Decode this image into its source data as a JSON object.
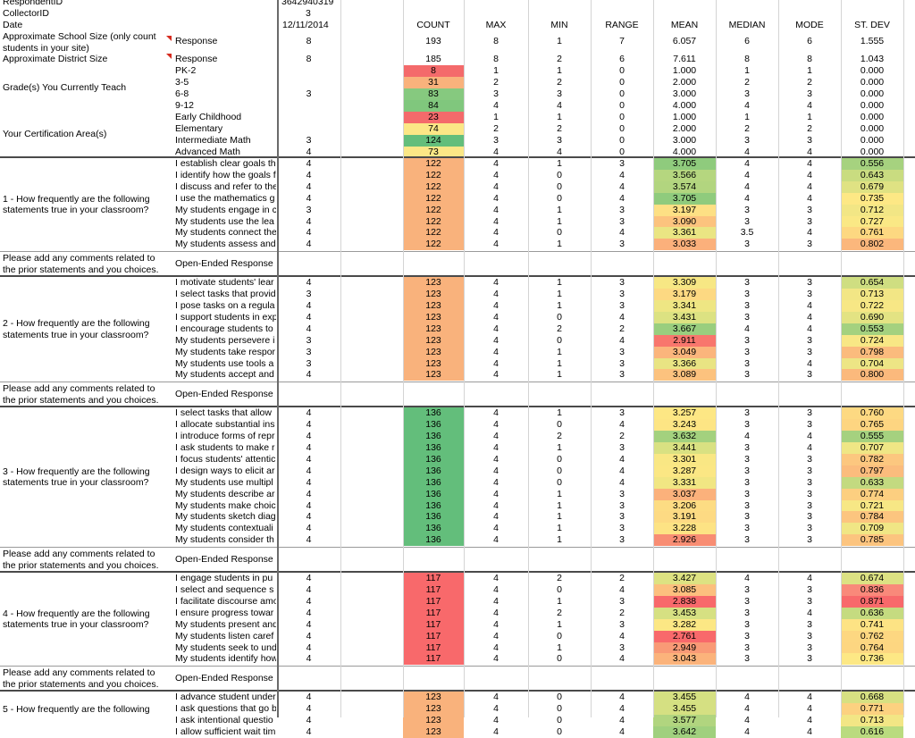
{
  "header_rows": {
    "respondent_id": {
      "label": "RespondentID",
      "value": "3642940319"
    },
    "collector_id": {
      "label": "CollectorID",
      "value": "3"
    },
    "date": {
      "label": "Date",
      "value": "12/11/2014"
    }
  },
  "stat_columns": [
    "COUNT",
    "MAX",
    "MIN",
    "RANGE",
    "MEAN",
    "MEDIAN",
    "MODE",
    "ST. DEV"
  ],
  "demographics": {
    "school_size": {
      "label": "Approximate School Size (only count students in your site)",
      "sub": "Response",
      "value": "8",
      "stats": [
        "193",
        "8",
        "1",
        "7",
        "6.057",
        "6",
        "6",
        "1.555"
      ]
    },
    "district_size": {
      "label": "Approximate District Size",
      "sub": "Response",
      "value": "8",
      "stats": [
        "185",
        "8",
        "2",
        "6",
        "7.611",
        "8",
        "8",
        "1.043"
      ]
    },
    "grades": {
      "label": "Grade(s) You Currently Teach",
      "rows": [
        {
          "sub": "PK-2",
          "value": "",
          "count": "8",
          "count_color": "#f46a6b",
          "stats": [
            "1",
            "1",
            "0",
            "1.000",
            "1",
            "1",
            "0.000"
          ]
        },
        {
          "sub": "3-5",
          "value": "",
          "count": "31",
          "count_color": "#f9b27c",
          "stats": [
            "2",
            "2",
            "0",
            "2.000",
            "2",
            "2",
            "0.000"
          ]
        },
        {
          "sub": "6-8",
          "value": "3",
          "count": "83",
          "count_color": "#86c97f",
          "stats": [
            "3",
            "3",
            "0",
            "3.000",
            "3",
            "3",
            "0.000"
          ]
        },
        {
          "sub": "9-12",
          "value": "",
          "count": "84",
          "count_color": "#80c77d",
          "stats": [
            "4",
            "4",
            "0",
            "4.000",
            "4",
            "4",
            "0.000"
          ]
        }
      ]
    },
    "certification": {
      "label": "Your Certification Area(s)",
      "rows": [
        {
          "sub": "Early Childhood",
          "value": "",
          "count": "23",
          "count_color": "#f46a6b",
          "stats": [
            "1",
            "1",
            "0",
            "1.000",
            "1",
            "1",
            "0.000"
          ]
        },
        {
          "sub": "Elementary",
          "value": "",
          "count": "74",
          "count_color": "#fbe786",
          "stats": [
            "2",
            "2",
            "0",
            "2.000",
            "2",
            "2",
            "0.000"
          ]
        },
        {
          "sub": "Intermediate Math",
          "value": "3",
          "count": "124",
          "count_color": "#63be7b",
          "stats": [
            "3",
            "3",
            "0",
            "3.000",
            "3",
            "3",
            "0.000"
          ]
        },
        {
          "sub": "Advanced Math",
          "value": "4",
          "count": "73",
          "count_color": "#fbe786",
          "stats": [
            "4",
            "4",
            "0",
            "4.000",
            "4",
            "4",
            "0.000"
          ]
        }
      ]
    }
  },
  "comment_label": "Please add any comments related to the prior statements and you choices.",
  "open_ended": "Open-Ended Response",
  "questions": [
    {
      "label": "1 - How frequently are the following statements true in your classroom?",
      "count": "122",
      "count_color": "#f9b27c",
      "rows": [
        {
          "sub": "I establish clear goals th",
          "value": "4",
          "max": "4",
          "min": "1",
          "range": "3",
          "mean": "3.705",
          "mean_color": "#8fcb7d",
          "median": "4",
          "mode": "4",
          "sd": "0.556",
          "sd_color": "#a6d27f"
        },
        {
          "sub": "I identify how the goals f",
          "value": "4",
          "max": "4",
          "min": "0",
          "range": "4",
          "mean": "3.566",
          "mean_color": "#b5d67f",
          "median": "4",
          "mode": "4",
          "sd": "0.643",
          "sd_color": "#c9dc80"
        },
        {
          "sub": "I discuss and refer to the",
          "value": "4",
          "max": "4",
          "min": "0",
          "range": "4",
          "mean": "3.574",
          "mean_color": "#b2d57f",
          "median": "4",
          "mode": "4",
          "sd": "0.679",
          "sd_color": "#dfe283"
        },
        {
          "sub": "I use the mathematics g",
          "value": "4",
          "max": "4",
          "min": "0",
          "range": "4",
          "mean": "3.705",
          "mean_color": "#8fcb7d",
          "median": "4",
          "mode": "4",
          "sd": "0.735",
          "sd_color": "#fde885"
        },
        {
          "sub": "My students engage in c",
          "value": "3",
          "max": "4",
          "min": "1",
          "range": "3",
          "mean": "3.197",
          "mean_color": "#fde084",
          "median": "3",
          "mode": "3",
          "sd": "0.712",
          "sd_color": "#f2e685"
        },
        {
          "sub": "My students use the lea",
          "value": "4",
          "max": "4",
          "min": "1",
          "range": "3",
          "mean": "3.090",
          "mean_color": "#fcc37e",
          "median": "3",
          "mode": "3",
          "sd": "0.727",
          "sd_color": "#fae885"
        },
        {
          "sub": "My students connect the",
          "value": "4",
          "max": "4",
          "min": "0",
          "range": "4",
          "mean": "3.361",
          "mean_color": "#eae583",
          "median": "3.5",
          "mode": "4",
          "sd": "0.761",
          "sd_color": "#fdd881"
        },
        {
          "sub": "My students assess and",
          "value": "4",
          "max": "4",
          "min": "1",
          "range": "3",
          "mean": "3.033",
          "mean_color": "#fbb07b",
          "median": "3",
          "mode": "3",
          "sd": "0.802",
          "sd_color": "#fbb77c"
        }
      ]
    },
    {
      "label": "2 - How frequently are the following statements true in your classroom?",
      "count": "123",
      "count_color": "#f9b27c",
      "rows": [
        {
          "sub": "I motivate students' lear",
          "value": "4",
          "max": "4",
          "min": "1",
          "range": "3",
          "mean": "3.309",
          "mean_color": "#f7e784",
          "median": "3",
          "mode": "3",
          "sd": "0.654",
          "sd_color": "#cfde81"
        },
        {
          "sub": "I select tasks that provid",
          "value": "3",
          "max": "4",
          "min": "1",
          "range": "3",
          "mean": "3.179",
          "mean_color": "#fdd982",
          "median": "3",
          "mode": "3",
          "sd": "0.713",
          "sd_color": "#f2e685"
        },
        {
          "sub": "I pose tasks on a regula",
          "value": "4",
          "max": "4",
          "min": "1",
          "range": "3",
          "mean": "3.341",
          "mean_color": "#eee683",
          "median": "3",
          "mode": "4",
          "sd": "0.722",
          "sd_color": "#f7e785"
        },
        {
          "sub": "I support students in exp",
          "value": "4",
          "max": "4",
          "min": "0",
          "range": "4",
          "mean": "3.431",
          "mean_color": "#dce282",
          "median": "3",
          "mode": "4",
          "sd": "0.690",
          "sd_color": "#e3e383"
        },
        {
          "sub": "I encourage students to",
          "value": "4",
          "max": "4",
          "min": "2",
          "range": "2",
          "mean": "3.667",
          "mean_color": "#99ce7e",
          "median": "4",
          "mode": "4",
          "sd": "0.553",
          "sd_color": "#a4d17f"
        },
        {
          "sub": "My students persevere i",
          "value": "3",
          "max": "4",
          "min": "0",
          "range": "4",
          "mean": "2.911",
          "mean_color": "#f8766d",
          "median": "3",
          "mode": "3",
          "sd": "0.724",
          "sd_color": "#f8e785"
        },
        {
          "sub": "My students take respor",
          "value": "3",
          "max": "4",
          "min": "1",
          "range": "3",
          "mean": "3.049",
          "mean_color": "#fbb57c",
          "median": "3",
          "mode": "3",
          "sd": "0.798",
          "sd_color": "#fbbb7d"
        },
        {
          "sub": "My students use tools a",
          "value": "3",
          "max": "4",
          "min": "1",
          "range": "3",
          "mean": "3.366",
          "mean_color": "#e9e483",
          "median": "3",
          "mode": "4",
          "sd": "0.704",
          "sd_color": "#ede585"
        },
        {
          "sub": "My students accept and",
          "value": "4",
          "max": "4",
          "min": "1",
          "range": "3",
          "mean": "3.089",
          "mean_color": "#fcc27e",
          "median": "3",
          "mode": "3",
          "sd": "0.800",
          "sd_color": "#fbb97c"
        }
      ]
    },
    {
      "label": "3 - How frequently are the following statements true in your classroom?",
      "count": "136",
      "count_color": "#63be7b",
      "rows": [
        {
          "sub": "I select tasks that allow",
          "value": "4",
          "max": "4",
          "min": "1",
          "range": "3",
          "mean": "3.257",
          "mean_color": "#fde784",
          "median": "3",
          "mode": "3",
          "sd": "0.760",
          "sd_color": "#fdd982"
        },
        {
          "sub": "I allocate substantial ins",
          "value": "4",
          "max": "4",
          "min": "0",
          "range": "4",
          "mean": "3.243",
          "mean_color": "#fde584",
          "median": "3",
          "mode": "3",
          "sd": "0.765",
          "sd_color": "#fdd581"
        },
        {
          "sub": "I introduce forms of repr",
          "value": "4",
          "max": "4",
          "min": "2",
          "range": "2",
          "mean": "3.632",
          "mean_color": "#a3d17e",
          "median": "4",
          "mode": "4",
          "sd": "0.555",
          "sd_color": "#a5d17f"
        },
        {
          "sub": "I ask students to make r",
          "value": "4",
          "max": "4",
          "min": "1",
          "range": "3",
          "mean": "3.441",
          "mean_color": "#d9e182",
          "median": "3",
          "mode": "4",
          "sd": "0.707",
          "sd_color": "#efe685"
        },
        {
          "sub": "I focus students' attentic",
          "value": "4",
          "max": "4",
          "min": "0",
          "range": "4",
          "mean": "3.301",
          "mean_color": "#f9e784",
          "median": "3",
          "mode": "3",
          "sd": "0.782",
          "sd_color": "#fcc77f"
        },
        {
          "sub": "I design ways to elicit ar",
          "value": "4",
          "max": "4",
          "min": "0",
          "range": "4",
          "mean": "3.287",
          "mean_color": "#fbe784",
          "median": "3",
          "mode": "3",
          "sd": "0.797",
          "sd_color": "#fbbc7d"
        },
        {
          "sub": "My students use multipl",
          "value": "4",
          "max": "4",
          "min": "0",
          "range": "4",
          "mean": "3.331",
          "mean_color": "#f1e683",
          "median": "3",
          "mode": "3",
          "sd": "0.633",
          "sd_color": "#c3da80"
        },
        {
          "sub": "My students describe ar",
          "value": "4",
          "max": "4",
          "min": "1",
          "range": "3",
          "mean": "3.037",
          "mean_color": "#fbb17b",
          "median": "3",
          "mode": "3",
          "sd": "0.774",
          "sd_color": "#fccf80"
        },
        {
          "sub": "My students make choic",
          "value": "4",
          "max": "4",
          "min": "1",
          "range": "3",
          "mean": "3.206",
          "mean_color": "#fddc83",
          "median": "3",
          "mode": "3",
          "sd": "0.721",
          "sd_color": "#f7e785"
        },
        {
          "sub": "My students sketch diag",
          "value": "4",
          "max": "4",
          "min": "1",
          "range": "3",
          "mean": "3.191",
          "mean_color": "#fdda83",
          "median": "3",
          "mode": "3",
          "sd": "0.784",
          "sd_color": "#fcc57f"
        },
        {
          "sub": "My students contextuali",
          "value": "4",
          "max": "4",
          "min": "1",
          "range": "3",
          "mean": "3.228",
          "mean_color": "#fde384",
          "median": "3",
          "mode": "3",
          "sd": "0.709",
          "sd_color": "#f0e685"
        },
        {
          "sub": "My students consider th",
          "value": "4",
          "max": "4",
          "min": "1",
          "range": "3",
          "mean": "2.926",
          "mean_color": "#f88d73",
          "median": "3",
          "mode": "3",
          "sd": "0.785",
          "sd_color": "#fcc47f"
        }
      ]
    },
    {
      "label": "4 - How frequently are the following statements true in your classroom?",
      "count": "117",
      "count_color": "#f8696b",
      "rows": [
        {
          "sub": "I engage students in pu",
          "value": "4",
          "max": "4",
          "min": "2",
          "range": "2",
          "mean": "3.427",
          "mean_color": "#dde282",
          "median": "4",
          "mode": "4",
          "sd": "0.674",
          "sd_color": "#dce183"
        },
        {
          "sub": "I select and sequence s",
          "value": "4",
          "max": "4",
          "min": "0",
          "range": "4",
          "mean": "3.085",
          "mean_color": "#fcbf7e",
          "median": "3",
          "mode": "3",
          "sd": "0.836",
          "sd_color": "#f9897a"
        },
        {
          "sub": "I facilitate discourse amo",
          "value": "4",
          "max": "4",
          "min": "1",
          "range": "3",
          "mean": "2.838",
          "mean_color": "#f8696b",
          "median": "3",
          "mode": "3",
          "sd": "0.871",
          "sd_color": "#f8696b"
        },
        {
          "sub": "I ensure progress towar",
          "value": "4",
          "max": "4",
          "min": "2",
          "range": "2",
          "mean": "3.453",
          "mean_color": "#d6e082",
          "median": "3",
          "mode": "4",
          "sd": "0.636",
          "sd_color": "#c5db80"
        },
        {
          "sub": "My students present and",
          "value": "4",
          "max": "4",
          "min": "1",
          "range": "3",
          "mean": "3.282",
          "mean_color": "#fce784",
          "median": "3",
          "mode": "3",
          "sd": "0.741",
          "sd_color": "#fde384"
        },
        {
          "sub": "My students listen caref",
          "value": "4",
          "max": "4",
          "min": "0",
          "range": "4",
          "mean": "2.761",
          "mean_color": "#f8696b",
          "median": "3",
          "mode": "3",
          "sd": "0.762",
          "sd_color": "#fdd781"
        },
        {
          "sub": "My students seek to und",
          "value": "4",
          "max": "4",
          "min": "1",
          "range": "3",
          "mean": "2.949",
          "mean_color": "#f99a76",
          "median": "3",
          "mode": "3",
          "sd": "0.764",
          "sd_color": "#fdd681"
        },
        {
          "sub": "My students identify how",
          "value": "4",
          "max": "4",
          "min": "0",
          "range": "4",
          "mean": "3.043",
          "mean_color": "#fbb37b",
          "median": "3",
          "mode": "3",
          "sd": "0.736",
          "sd_color": "#fde885"
        }
      ]
    },
    {
      "label": "5 - How frequently are the following",
      "count": "123",
      "count_color": "#f9b27c",
      "rows": [
        {
          "sub": "I advance student under",
          "value": "4",
          "max": "4",
          "min": "0",
          "range": "4",
          "mean": "3.455",
          "mean_color": "#d5e082",
          "median": "4",
          "mode": "4",
          "sd": "0.668",
          "sd_color": "#d7e082"
        },
        {
          "sub": "I ask questions that go b",
          "value": "4",
          "max": "4",
          "min": "0",
          "range": "4",
          "mean": "3.455",
          "mean_color": "#d5e082",
          "median": "4",
          "mode": "4",
          "sd": "0.771",
          "sd_color": "#fcd180"
        },
        {
          "sub": "I ask intentional questio",
          "value": "4",
          "max": "4",
          "min": "0",
          "range": "4",
          "mean": "3.577",
          "mean_color": "#b1d57f",
          "median": "4",
          "mode": "4",
          "sd": "0.713",
          "sd_color": "#f2e685"
        },
        {
          "sub": "I allow sufficient wait tim",
          "value": "4",
          "max": "4",
          "min": "0",
          "range": "4",
          "mean": "3.642",
          "mean_color": "#a0d07e",
          "median": "4",
          "mode": "4",
          "sd": "0.616",
          "sd_color": "#badb7f"
        }
      ]
    }
  ]
}
